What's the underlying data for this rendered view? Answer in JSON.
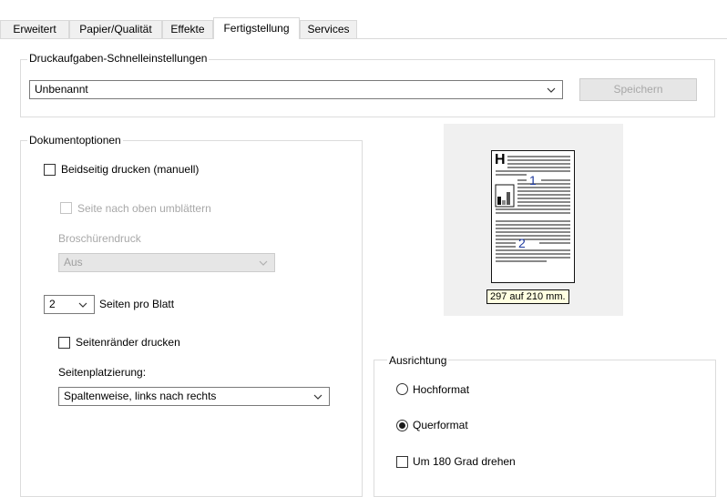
{
  "tabs": [
    {
      "label": "Erweitert"
    },
    {
      "label": "Papier/Qualität"
    },
    {
      "label": "Effekte"
    },
    {
      "label": "Fertigstellung",
      "active": true
    },
    {
      "label": "Services"
    }
  ],
  "quick_settings": {
    "legend": "Druckaufgaben-Schnelleinstellungen",
    "selected": "Unbenannt",
    "save_label": "Speichern"
  },
  "document_options": {
    "legend": "Dokumentoptionen",
    "duplex_label": "Beidseitig drucken (manuell)",
    "duplex_checked": false,
    "flip_label": "Seite nach oben umblättern",
    "flip_checked": false,
    "booklet_label": "Broschürendruck",
    "booklet_value": "Aus",
    "pages_per_sheet_value": "2",
    "pages_per_sheet_label": "Seiten pro Blatt",
    "borders_label": "Seitenränder drucken",
    "borders_checked": false,
    "placement_label": "Seitenplatzierung:",
    "placement_value": "Spaltenweise, links nach rechts"
  },
  "preview": {
    "header_letter": "H",
    "page1_number": "1",
    "page2_number": "2",
    "dimension_text": "297 auf 210 mm."
  },
  "orientation": {
    "legend": "Ausrichtung",
    "portrait_label": "Hochformat",
    "landscape_label": "Querformat",
    "selected": "landscape",
    "rotate_label": "Um 180 Grad drehen",
    "rotate_checked": false
  },
  "colors": {
    "accent_number": "#1f3a9e",
    "disabled_text": "#a8a8a8",
    "tooltip_bg": "#ffffe1"
  }
}
